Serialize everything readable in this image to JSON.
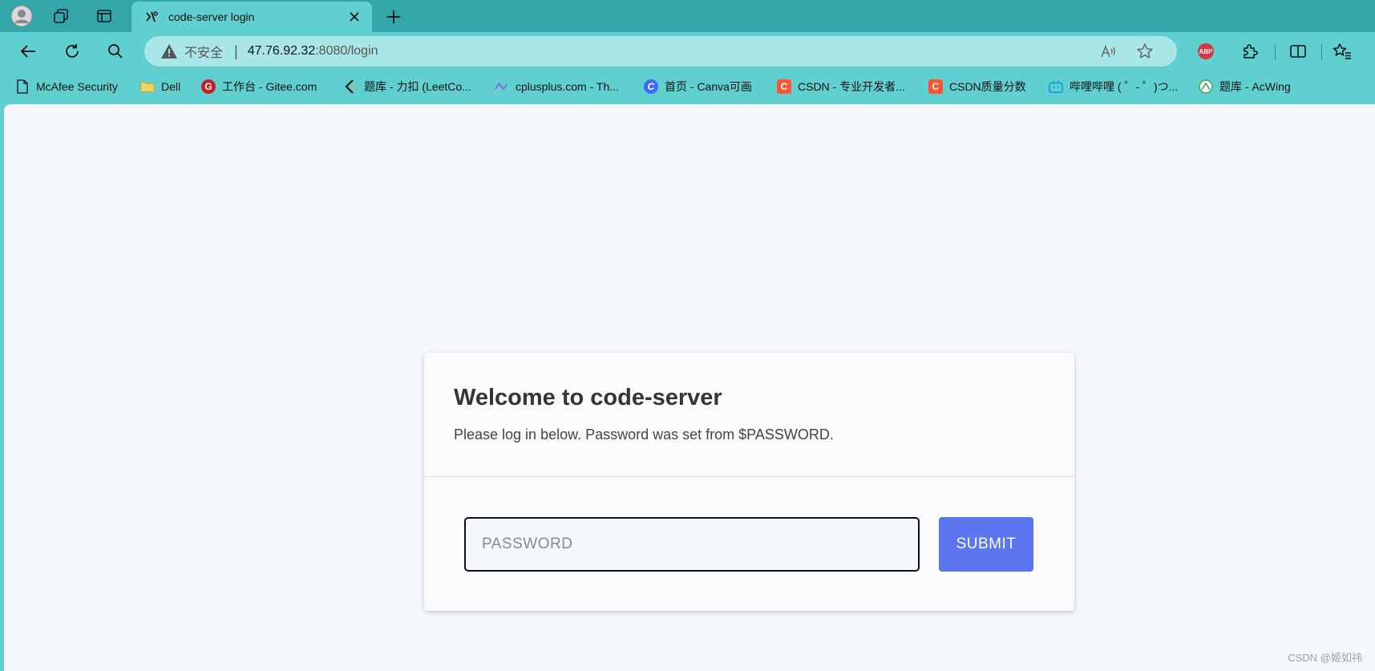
{
  "browser": {
    "tab": {
      "title": "code-server login"
    },
    "address": {
      "security_label": "不安全",
      "separator": "|",
      "url_host": "47.76.92.32",
      "url_path": ":8080/login"
    },
    "extension_abp": "ABP",
    "bookmarks": [
      {
        "label": "McAfee Security",
        "icon": "document-icon"
      },
      {
        "label": "Dell",
        "icon": "folder-icon"
      },
      {
        "label": "工作台 - Gitee.com",
        "icon": "gitee-icon"
      },
      {
        "label": "题库 - 力扣 (LeetCo...",
        "icon": "leetcode-icon"
      },
      {
        "label": "cplusplus.com - Th...",
        "icon": "cplusplus-icon"
      },
      {
        "label": "首页 - Canva可画",
        "icon": "canva-icon"
      },
      {
        "label": "CSDN - 专业开发者...",
        "icon": "csdn-icon"
      },
      {
        "label": "CSDN质量分数",
        "icon": "csdn-icon"
      },
      {
        "label": "哔哩哔哩 ( ゜- ゜)つ...",
        "icon": "bilibili-icon"
      },
      {
        "label": "题库 - AcWing",
        "icon": "acwing-icon"
      }
    ],
    "colors": {
      "chrome": "#5fcfcf",
      "tabstrip": "#32a6a8",
      "omnibox": "#a9e6e6"
    }
  },
  "page": {
    "title": "Welcome to code-server",
    "subtitle": "Please log in below. Password was set from $PASSWORD.",
    "password_placeholder": "PASSWORD",
    "submit_label": "SUBMIT",
    "submit_color": "#5c75f0"
  },
  "watermark": "CSDN @姬如祎"
}
